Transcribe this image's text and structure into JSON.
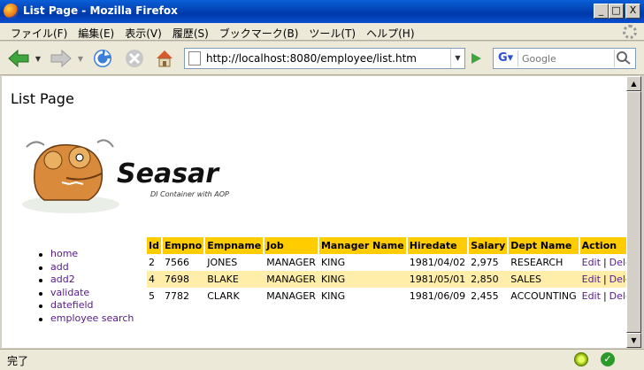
{
  "window": {
    "title": "List Page - Mozilla Firefox",
    "min_glyph": "_",
    "max_glyph": "□",
    "close_glyph": "X"
  },
  "menu": {
    "items": [
      "ファイル(F)",
      "編集(E)",
      "表示(V)",
      "履歴(S)",
      "ブックマーク(B)",
      "ツール(T)",
      "ヘルプ(H)"
    ]
  },
  "toolbar": {
    "url": "http://localhost:8080/employee/list.htm",
    "search_placeholder": "Google"
  },
  "page": {
    "heading": "List Page",
    "logo_text": "Seasar",
    "logo_tagline": "DI Container with AOP",
    "nav": [
      "home",
      "add",
      "add2",
      "validate",
      "datefield",
      "employee search"
    ],
    "table": {
      "headers": [
        "Id",
        "Empno",
        "Empname",
        "Job",
        "Manager Name",
        "Hiredate",
        "Salary",
        "Dept Name",
        "Action"
      ],
      "rows": [
        {
          "id": "2",
          "empno": "7566",
          "empname": "JONES",
          "job": "MANAGER",
          "manager": "KING",
          "hiredate": "1981/04/02",
          "salary": "2,975",
          "dept": "RESEARCH"
        },
        {
          "id": "4",
          "empno": "7698",
          "empname": "BLAKE",
          "job": "MANAGER",
          "manager": "KING",
          "hiredate": "1981/05/01",
          "salary": "2,850",
          "dept": "SALES"
        },
        {
          "id": "5",
          "empno": "7782",
          "empname": "CLARK",
          "job": "MANAGER",
          "manager": "KING",
          "hiredate": "1981/06/09",
          "salary": "2,455",
          "dept": "ACCOUNTING"
        }
      ],
      "edit_label": "Edit",
      "delete_label": "Delete",
      "separator": "|"
    }
  },
  "status": {
    "text": "完了"
  },
  "colors": {
    "header_bg": "#ffcc00",
    "alt_row_bg": "#ffeeaa",
    "link": "#551a8b"
  }
}
